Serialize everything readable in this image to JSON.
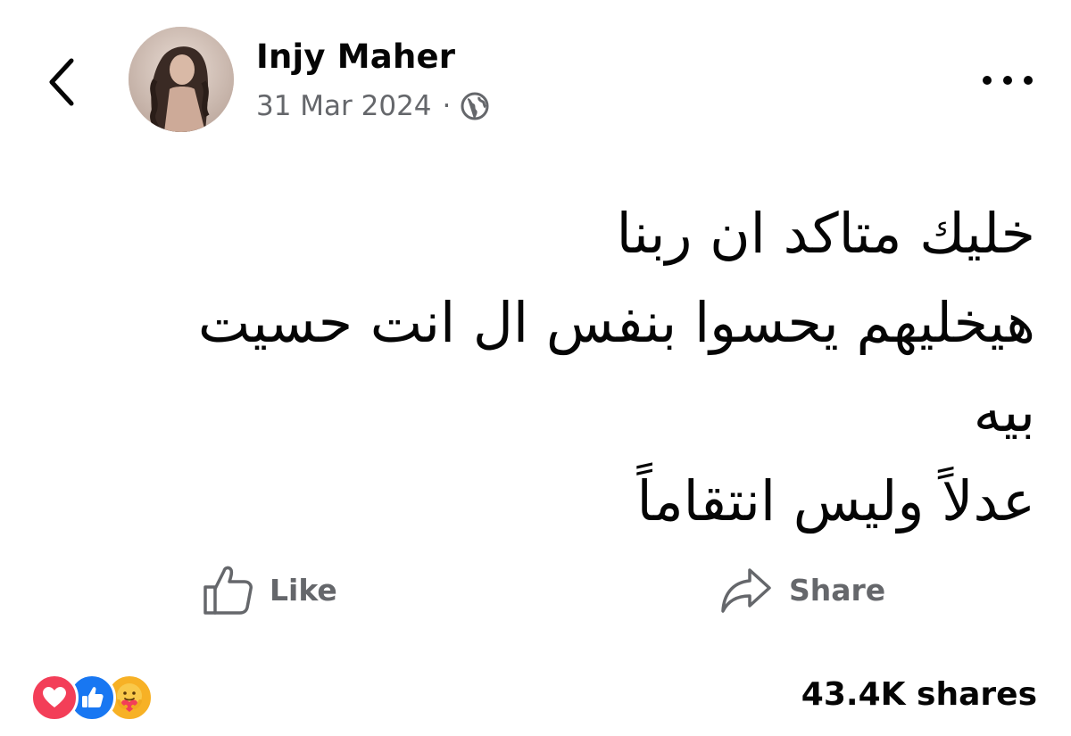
{
  "post": {
    "author_name": "Injy Maher",
    "date": "31 Mar 2024",
    "separator": "·",
    "privacy_icon": "globe-icon",
    "text_lines": [
      "خليك متاكد ان ربنا",
      "هيخليهم يحسوا بنفس ال انت حسيت",
      "بيه",
      "عدلاً وليس انتقاماً"
    ]
  },
  "header": {
    "back_icon": "chevron-left-icon",
    "more_icon": "more-horizontal-icon"
  },
  "actions": {
    "like_label": "Like",
    "share_label": "Share"
  },
  "footer": {
    "reactions": [
      "love",
      "like",
      "care"
    ],
    "shares_text": "43.4K shares"
  },
  "colors": {
    "text_primary": "#050505",
    "text_secondary": "#65676b",
    "love": "#f33e58",
    "like": "#1877f2",
    "care": "#f7b125"
  }
}
